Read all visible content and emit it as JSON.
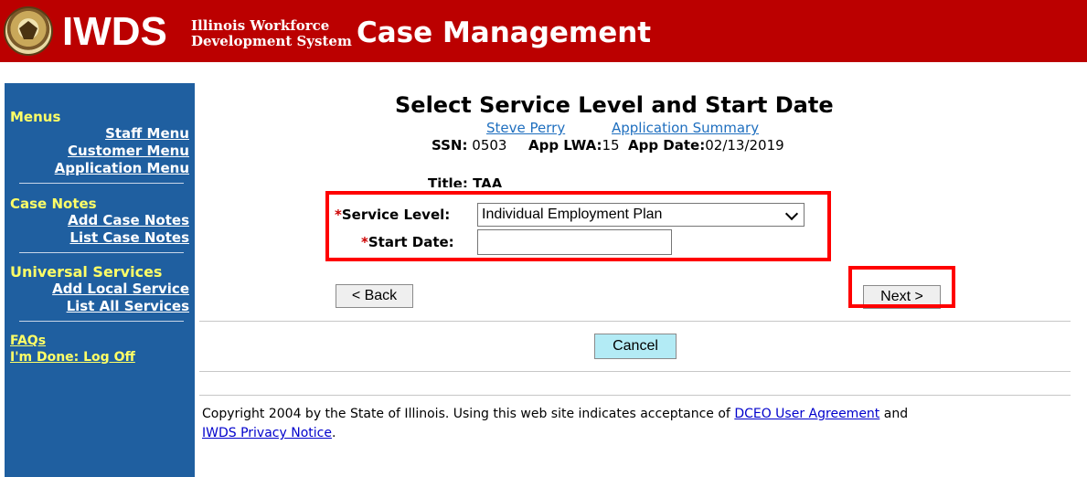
{
  "header": {
    "logo_text": "IWDS",
    "logo_sub_line1": "Illinois Workforce",
    "logo_sub_line2": "Development System",
    "title": "Case Management"
  },
  "sidebar": {
    "menus_heading": "Menus",
    "menu_links": [
      "Staff Menu",
      "Customer Menu",
      "Application Menu"
    ],
    "case_notes_heading": "Case Notes",
    "case_notes_links": [
      "Add Case Notes",
      "List Case Notes"
    ],
    "universal_heading": "Universal Services",
    "universal_links": [
      "Add Local Service",
      "List All Services"
    ],
    "faqs": "FAQs",
    "logoff": "I'm Done: Log Off"
  },
  "page": {
    "title": "Select Service Level and Start Date",
    "customer_link": "Steve Perry",
    "summary_link": "Application Summary",
    "ssn_label": "SSN:",
    "ssn_value": "0503",
    "lwa_label": "App LWA:",
    "lwa_value": "15",
    "date_label": "App Date:",
    "date_value": "02/13/2019",
    "title_label": "Title: TAA"
  },
  "form": {
    "required_mark": "*",
    "service_level_label": "Service Level:",
    "service_level_value": "Individual Employment Plan",
    "start_date_label": "Start Date:",
    "start_date_value": ""
  },
  "buttons": {
    "back": "< Back",
    "next": "Next >",
    "cancel": "Cancel"
  },
  "footer": {
    "text_before": "Copyright 2004 by the State of Illinois. Using this web site indicates acceptance of ",
    "agreement_link": "DCEO User Agreement",
    "text_and": " and",
    "privacy_link": "IWDS Privacy Notice",
    "text_end": "."
  },
  "colors": {
    "header_bg": "#bb0000",
    "sidebar_bg": "#1f5fa0",
    "section_heading": "#ffff66",
    "highlight": "#ff0000",
    "cancel_bg": "#b3ebf5"
  }
}
